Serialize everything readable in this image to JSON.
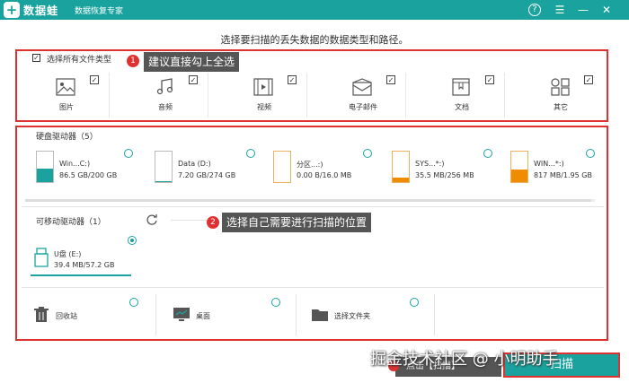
{
  "titlebar": {
    "logo": "+",
    "app_name": "数据蛙",
    "app_sub": "数据恢复专家",
    "help": "?",
    "menu": "☰",
    "minimize": "—",
    "close": "✕"
  },
  "prompt": "选择要扫描的丢失数据的数据类型和路径。",
  "select_all": {
    "check": "✓",
    "label": "选择所有文件类型"
  },
  "callout1": {
    "num": "1",
    "text": "建议直接勾上全选"
  },
  "callout2": {
    "num": "2",
    "text": "选择自己需要进行扫描的位置"
  },
  "file_types": [
    {
      "label": "图片",
      "check": "✓",
      "icon": "image-icon"
    },
    {
      "label": "音频",
      "check": "✓",
      "icon": "music-icon"
    },
    {
      "label": "视频",
      "check": "✓",
      "icon": "video-icon"
    },
    {
      "label": "电子邮件",
      "check": "✓",
      "icon": "mail-icon"
    },
    {
      "label": "文档",
      "check": "✓",
      "icon": "document-icon"
    },
    {
      "label": "其它",
      "check": "✓",
      "icon": "other-icon"
    }
  ],
  "hard_drives": {
    "label": "硬盘驱动器（5）",
    "items": [
      {
        "name": "Win...C:)",
        "size": "86.5 GB/200 GB",
        "fill": 0.43,
        "color": "#1aa39e"
      },
      {
        "name": "Data (D:)",
        "size": "7.20 GB/274 GB",
        "fill": 0.03,
        "color": "#1aa39e"
      },
      {
        "name": "分区...:)",
        "size": "0.00  B/16.0 MB",
        "fill": 0.0,
        "color": "#f08c00"
      },
      {
        "name": "SYS...*:)",
        "size": "35.5 MB/256 MB",
        "fill": 0.14,
        "color": "#f08c00"
      },
      {
        "name": "WIN...*:)",
        "size": "817 MB/1.95 GB",
        "fill": 0.42,
        "color": "#f08c00"
      }
    ]
  },
  "removable": {
    "label": "可移动驱动器（1）",
    "items": [
      {
        "name": "U盘 (E:)",
        "size": "39.4 MB/57.2 GB"
      }
    ]
  },
  "locations": [
    {
      "label": "回收站",
      "icon": "recycle-bin-icon"
    },
    {
      "label": "桌面",
      "icon": "desktop-icon"
    },
    {
      "label": "选择文件夹",
      "icon": "folder-icon"
    }
  ],
  "bottom": {
    "hint": "点击【扫描】",
    "scan_button": "扫描",
    "watermark": "掘金技术社区 @ 小明助手"
  }
}
